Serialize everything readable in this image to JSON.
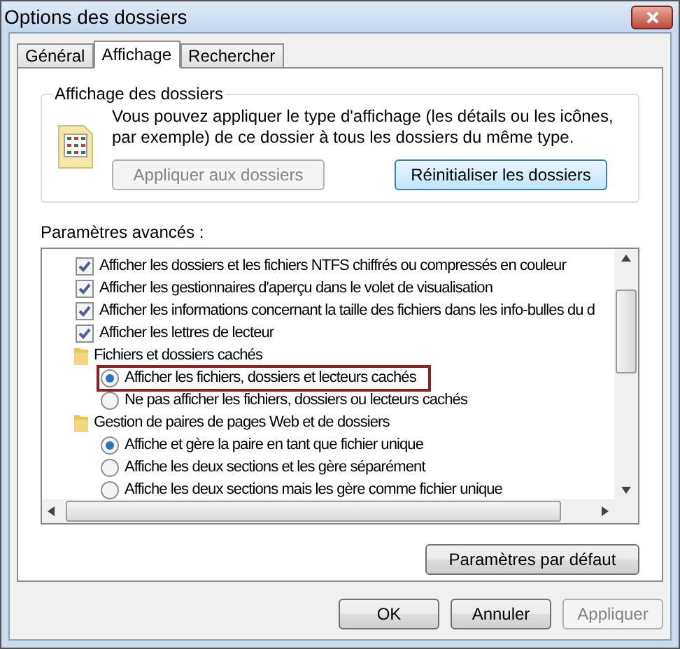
{
  "window": {
    "title": "Options des dossiers"
  },
  "tabs": [
    {
      "label": "Général",
      "selected": false
    },
    {
      "label": "Affichage",
      "selected": true
    },
    {
      "label": "Rechercher",
      "selected": false
    }
  ],
  "folder_views": {
    "title": "Affichage des dossiers",
    "description": "Vous pouvez appliquer le type d'affichage (les détails ou les icônes, par exemple) de ce dossier à tous les dossiers du même type.",
    "buttons": [
      {
        "label": "Appliquer aux dossiers",
        "disabled": true
      },
      {
        "label": "Réinitialiser les dossiers",
        "disabled": false
      }
    ]
  },
  "advanced": {
    "label": "Paramètres avancés :",
    "items": [
      {
        "kind": "checkbox",
        "label": "Afficher les dossiers et les fichiers NTFS chiffrés ou compressés en couleur",
        "checked": true
      },
      {
        "kind": "checkbox",
        "label": "Afficher les gestionnaires d'aperçu dans le volet de visualisation",
        "checked": true
      },
      {
        "kind": "checkbox",
        "label": "Afficher les informations concernant la taille des fichiers dans les info-bulles du d",
        "checked": true
      },
      {
        "kind": "checkbox",
        "label": "Afficher les lettres de lecteur",
        "checked": true
      },
      {
        "kind": "folder",
        "label": "Fichiers et dossiers cachés",
        "children": [
          {
            "kind": "radio",
            "label": "Afficher les fichiers, dossiers et lecteurs cachés",
            "selected": true,
            "highlighted": true
          },
          {
            "kind": "radio",
            "label": "Ne pas afficher les fichiers, dossiers ou lecteurs cachés",
            "selected": false,
            "highlighted": false
          }
        ]
      },
      {
        "kind": "folder",
        "label": "Gestion de paires de pages Web et de dossiers",
        "children": [
          {
            "kind": "radio",
            "label": "Affiche et gère la paire en tant que fichier unique",
            "selected": true,
            "highlighted": false
          },
          {
            "kind": "radio",
            "label": "Affiche les deux sections et les gère séparément",
            "selected": false,
            "highlighted": false
          },
          {
            "kind": "radio",
            "label": "Affiche les deux sections mais les gère comme fichier unique",
            "selected": false,
            "highlighted": false
          }
        ]
      }
    ],
    "default_button": "Paramètres par défaut"
  },
  "buttons": [
    {
      "label": "OK",
      "disabled": false
    },
    {
      "label": "Annuler",
      "disabled": false
    },
    {
      "label": "Appliquer",
      "disabled": true
    }
  ]
}
